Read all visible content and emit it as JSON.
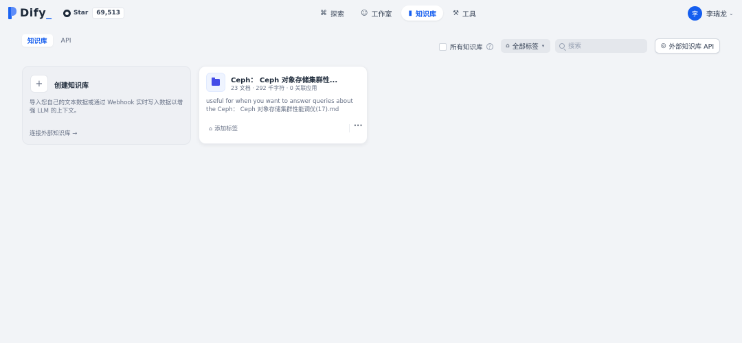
{
  "app": {
    "logo_text": "Dify",
    "logo_suffix": "_"
  },
  "github": {
    "star_label": "Star",
    "star_count": "69,513",
    "icon": "github-icon"
  },
  "nav": {
    "items": [
      {
        "label": "探索",
        "icon": "compass-icon",
        "active": false
      },
      {
        "label": "工作室",
        "icon": "robot-icon",
        "active": false
      },
      {
        "label": "知识库",
        "icon": "book-icon",
        "active": true
      },
      {
        "label": "工具",
        "icon": "hammer-icon",
        "active": false
      }
    ]
  },
  "user": {
    "avatar_initial": "李",
    "name": "李瑞龙"
  },
  "tabs": [
    {
      "label": "知识库",
      "active": true
    },
    {
      "label": "API",
      "active": false
    }
  ],
  "filters": {
    "all_kb_label": "所有知识库",
    "all_kb_checked": false,
    "tag_select_label": "全部标签",
    "search_placeholder": "搜索",
    "search_value": "",
    "external_api_label": "外部知识库 API"
  },
  "create_card": {
    "title": "创建知识库",
    "description": "导入您自己的文本数据或通过 Webhook 实时写入数据以增强 LLM 的上下文。",
    "link": "连接外部知识库 →"
  },
  "datasets": [
    {
      "title": "Ceph： Ceph 对象存储集群性...",
      "meta": "23 文档 · 292 千字符 · 0 关联应用",
      "description": "useful for when you want to answer queries about the Ceph： Ceph 对象存储集群性能调优(17).md",
      "tag_label": "添加标签"
    }
  ],
  "colors": {
    "accent": "#155eef",
    "background": "#f2f4f7",
    "dataset_icon": "#444ce7"
  }
}
